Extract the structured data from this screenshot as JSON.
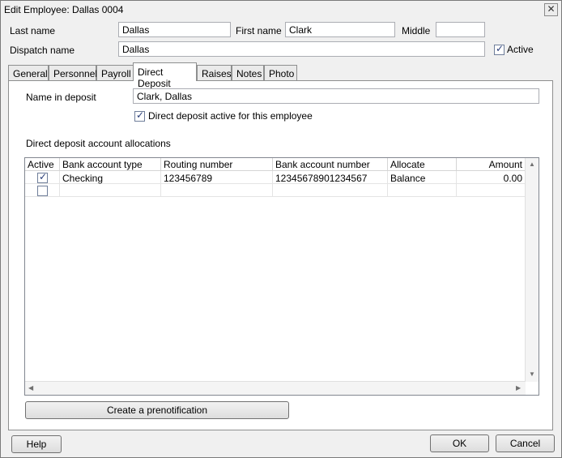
{
  "window": {
    "title": "Edit Employee: Dallas 0004",
    "close_glyph": "✕"
  },
  "header": {
    "last_name_label": "Last name",
    "last_name_value": "Dallas",
    "first_name_label": "First name",
    "first_name_value": "Clark",
    "middle_label": "Middle",
    "middle_value": "",
    "dispatch_name_label": "Dispatch name",
    "dispatch_name_value": "Dallas",
    "active_label": "Active",
    "active_checked": true
  },
  "tabs": [
    {
      "label": "General"
    },
    {
      "label": "Personnel"
    },
    {
      "label": "Payroll"
    },
    {
      "label": "Direct Deposit"
    },
    {
      "label": "Raises"
    },
    {
      "label": "Notes"
    },
    {
      "label": "Photo"
    }
  ],
  "active_tab": "Direct Deposit",
  "direct_deposit": {
    "name_in_deposit_label": "Name in deposit",
    "name_in_deposit_value": "Clark, Dallas",
    "active_checkbox_label": "Direct deposit active for this employee",
    "active_checked": true,
    "allocations_label": "Direct deposit account allocations",
    "columns": [
      "Active",
      "Bank account type",
      "Routing number",
      "Bank account number",
      "Allocate",
      "Amount"
    ],
    "rows": [
      {
        "active": true,
        "type": "Checking",
        "routing": "123456789",
        "account": "12345678901234567",
        "allocate": "Balance",
        "amount": "0.00"
      },
      {
        "active": false,
        "type": "",
        "routing": "",
        "account": "",
        "allocate": "",
        "amount": ""
      }
    ],
    "prenotification_button": "Create a prenotification"
  },
  "footer": {
    "help_button": "Help",
    "ok_button": "OK",
    "cancel_button": "Cancel"
  },
  "icons": {
    "check": "✓",
    "scroll_up": "▲",
    "scroll_down": "▼",
    "scroll_left": "◀",
    "scroll_right": "▶"
  }
}
